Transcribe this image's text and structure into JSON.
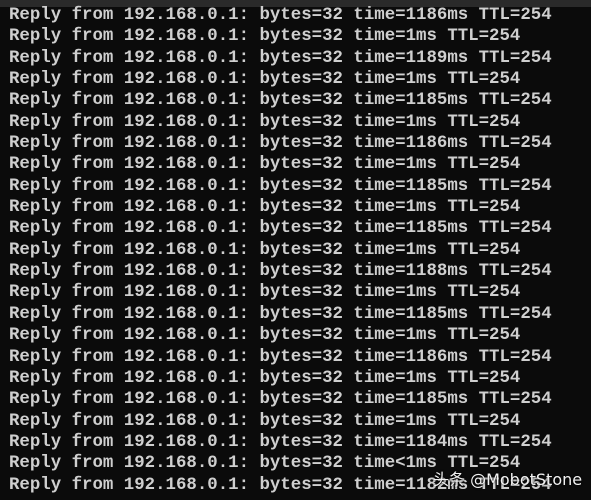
{
  "console": {
    "lines": [
      "Reply from 192.168.0.1: bytes=32 time=1186ms TTL=254",
      "Reply from 192.168.0.1: bytes=32 time=1ms TTL=254",
      "Reply from 192.168.0.1: bytes=32 time=1189ms TTL=254",
      "Reply from 192.168.0.1: bytes=32 time=1ms TTL=254",
      "Reply from 192.168.0.1: bytes=32 time=1185ms TTL=254",
      "Reply from 192.168.0.1: bytes=32 time=1ms TTL=254",
      "Reply from 192.168.0.1: bytes=32 time=1186ms TTL=254",
      "Reply from 192.168.0.1: bytes=32 time=1ms TTL=254",
      "Reply from 192.168.0.1: bytes=32 time=1185ms TTL=254",
      "Reply from 192.168.0.1: bytes=32 time=1ms TTL=254",
      "Reply from 192.168.0.1: bytes=32 time=1185ms TTL=254",
      "Reply from 192.168.0.1: bytes=32 time=1ms TTL=254",
      "Reply from 192.168.0.1: bytes=32 time=1188ms TTL=254",
      "Reply from 192.168.0.1: bytes=32 time=1ms TTL=254",
      "Reply from 192.168.0.1: bytes=32 time=1185ms TTL=254",
      "Reply from 192.168.0.1: bytes=32 time=1ms TTL=254",
      "Reply from 192.168.0.1: bytes=32 time=1186ms TTL=254",
      "Reply from 192.168.0.1: bytes=32 time=1ms TTL=254",
      "Reply from 192.168.0.1: bytes=32 time=1185ms TTL=254",
      "Reply from 192.168.0.1: bytes=32 time=1ms TTL=254",
      "Reply from 192.168.0.1: bytes=32 time=1184ms TTL=254",
      "Reply from 192.168.0.1: bytes=32 time<1ms TTL=254",
      "Reply from 192.168.0.1: bytes=32 time=1182ms TTL=254"
    ]
  },
  "watermark": "头条 @MobotStone",
  "colors": {
    "background": "#0b0b0b",
    "text": "#cfcfcf"
  }
}
